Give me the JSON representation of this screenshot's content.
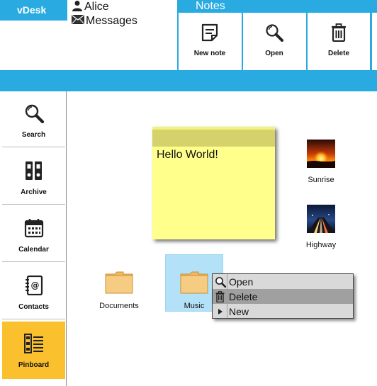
{
  "app": {
    "brand": "vDesk"
  },
  "user": {
    "name": "Alice",
    "messages_label": "Messages"
  },
  "ribbon": {
    "title": "Notes",
    "buttons": [
      {
        "label": "New note",
        "icon": "note-icon"
      },
      {
        "label": "Open",
        "icon": "search-icon"
      },
      {
        "label": "Delete",
        "icon": "trash-icon"
      }
    ]
  },
  "sidebar": {
    "items": [
      {
        "label": "Search",
        "icon": "search-icon"
      },
      {
        "label": "Archive",
        "icon": "binders-icon"
      },
      {
        "label": "Calendar",
        "icon": "calendar-icon"
      },
      {
        "label": "Contacts",
        "icon": "address-book-icon"
      },
      {
        "label": "Pinboard",
        "icon": "pinboard-icon",
        "active": true
      }
    ]
  },
  "desktop": {
    "note": {
      "text": "Hello World!"
    },
    "images": [
      {
        "label": "Sunrise"
      },
      {
        "label": "Highway"
      }
    ],
    "folders": [
      {
        "label": "Documents"
      },
      {
        "label": "Music",
        "selected": true
      }
    ]
  },
  "context_menu": {
    "items": [
      {
        "label": "Open",
        "icon": "search-icon"
      },
      {
        "label": "Delete",
        "icon": "trash-icon",
        "highlighted": true
      },
      {
        "label": "New",
        "icon": "arrow-right-icon"
      }
    ]
  },
  "colors": {
    "accent": "#29abe2",
    "active": "#fbc02d",
    "note": "#ffff8c",
    "selection": "#b3e1f7"
  }
}
